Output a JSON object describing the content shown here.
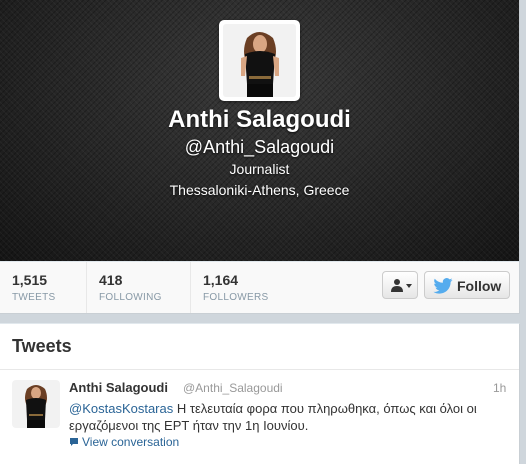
{
  "profile": {
    "display_name": "Anthi Salagoudi",
    "screen_name": "@Anthi_Salagoudi",
    "bio": "Journalist",
    "location": "Thessaloniki-Athens, Greece"
  },
  "stats": [
    {
      "value": "1,515",
      "label": "TWEETS"
    },
    {
      "value": "418",
      "label": "FOLLOWING"
    },
    {
      "value": "1,164",
      "label": "FOLLOWERS"
    }
  ],
  "actions": {
    "follow_label": "Follow",
    "user_dropdown_icon": "person-icon"
  },
  "tweets_section": {
    "title": "Tweets",
    "items": [
      {
        "author": "Anthi Salagoudi",
        "handle": "@Anthi_Salagoudi",
        "time": "1h",
        "mention": "@KostasKostaras",
        "text": " Η τελευταία φορα που πληρωθηκα, όπως και όλοι οι εργαζόμενοι της ΕΡΤ ήταν την 1η Ιουνίου.",
        "view_conversation": "View conversation"
      }
    ]
  },
  "colors": {
    "link": "#2a6496",
    "twitter_blue": "#55acee",
    "header_dark": "#222222"
  }
}
